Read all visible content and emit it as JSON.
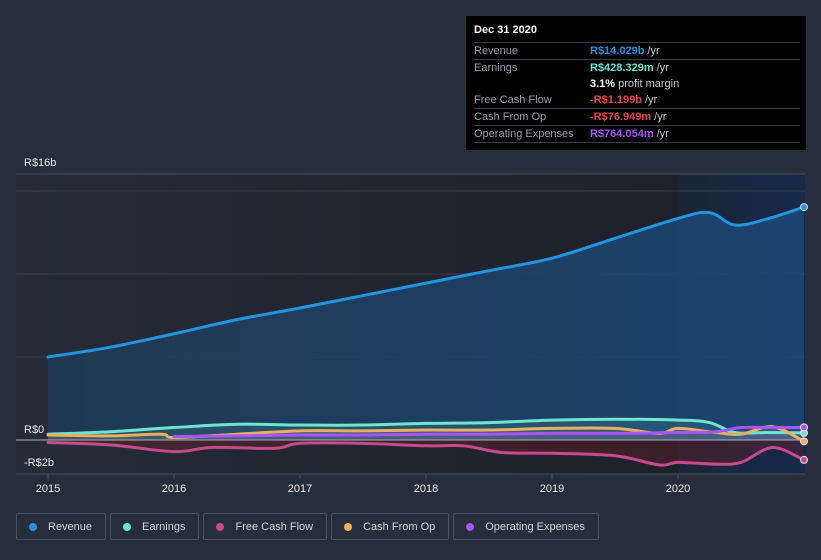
{
  "tooltip": {
    "date": "Dec 31 2020",
    "rows": [
      {
        "label": "Revenue",
        "value": "R$14.029b",
        "unit": "/yr",
        "color": "#2394df"
      },
      {
        "label": "Earnings",
        "value": "R$428.329m",
        "unit": "/yr",
        "color": "#6ce5d1"
      },
      {
        "label": "",
        "value": "3.1%",
        "unit": "profit margin",
        "color": "#ffffff"
      },
      {
        "label": "Free Cash Flow",
        "value": "-R$1.199b",
        "unit": "/yr",
        "color": "#e64545"
      },
      {
        "label": "Cash From Op",
        "value": "-R$76.949m",
        "unit": "/yr",
        "color": "#e64545"
      },
      {
        "label": "Operating Expenses",
        "value": "R$764.054m",
        "unit": "/yr",
        "color": "#a855f7"
      }
    ]
  },
  "legend": [
    {
      "label": "Revenue",
      "color": "#2394df"
    },
    {
      "label": "Earnings",
      "color": "#6ce5d1"
    },
    {
      "label": "Free Cash Flow",
      "color": "#c84a8c"
    },
    {
      "label": "Cash From Op",
      "color": "#e8b060"
    },
    {
      "label": "Operating Expenses",
      "color": "#a855f7"
    }
  ],
  "chart_data": {
    "type": "area",
    "title": "",
    "xlabel": "",
    "ylabel": "",
    "ylim": [
      -2,
      16
    ],
    "y_unit": "R$ billions",
    "y_tick_labels": [
      {
        "value": 16,
        "label": "R$16b"
      },
      {
        "value": 0,
        "label": "R$0"
      },
      {
        "value": -2,
        "label": "-R$2b"
      }
    ],
    "gridlines": [
      15,
      10,
      5
    ],
    "x_ticks": [
      "2015",
      "2016",
      "2017",
      "2018",
      "2019",
      "2020"
    ],
    "xlim": [
      2015,
      2021
    ],
    "highlight_start": 2020,
    "series": [
      {
        "name": "Revenue",
        "color": "#2394df",
        "x": [
          2015,
          2015.5,
          2016,
          2016.5,
          2017,
          2017.5,
          2018,
          2018.5,
          2019,
          2019.5,
          2020,
          2020.25,
          2020.45,
          2020.7,
          2021
        ],
        "values": [
          5.0,
          5.6,
          6.4,
          7.25,
          7.95,
          8.7,
          9.45,
          10.2,
          10.95,
          12.15,
          13.35,
          13.7,
          12.95,
          13.3,
          14.03
        ]
      },
      {
        "name": "Earnings",
        "color": "#6ce5d1",
        "x": [
          2015,
          2015.5,
          2016,
          2016.5,
          2017,
          2017.5,
          2018,
          2018.5,
          2019,
          2019.5,
          2020,
          2020.25,
          2020.45,
          2020.7,
          2021
        ],
        "values": [
          0.35,
          0.5,
          0.75,
          0.95,
          0.9,
          0.9,
          1.0,
          1.05,
          1.2,
          1.25,
          1.2,
          1.05,
          0.45,
          0.45,
          0.43
        ]
      },
      {
        "name": "Free Cash Flow",
        "color": "#c84a8c",
        "x": [
          2015,
          2015.5,
          2016,
          2016.3,
          2016.8,
          2017,
          2017.5,
          2018,
          2018.3,
          2018.6,
          2019,
          2019.5,
          2019.85,
          2020,
          2020.3,
          2020.5,
          2020.75,
          2021
        ],
        "values": [
          -0.15,
          -0.3,
          -0.7,
          -0.45,
          -0.5,
          -0.2,
          -0.2,
          -0.35,
          -0.35,
          -0.75,
          -0.8,
          -0.95,
          -1.5,
          -1.35,
          -1.45,
          -1.35,
          -0.45,
          -1.2
        ]
      },
      {
        "name": "Cash From Op",
        "color": "#e8b060",
        "x": [
          2015,
          2015.5,
          2015.9,
          2016,
          2016.5,
          2017,
          2017.5,
          2018,
          2018.5,
          2019,
          2019.5,
          2019.85,
          2020,
          2020.3,
          2020.5,
          2020.75,
          2021
        ],
        "values": [
          0.3,
          0.25,
          0.35,
          0.15,
          0.35,
          0.55,
          0.55,
          0.6,
          0.6,
          0.7,
          0.7,
          0.4,
          0.7,
          0.45,
          0.35,
          0.8,
          -0.08
        ]
      },
      {
        "name": "Operating Expenses",
        "color": "#a855f7",
        "x": [
          2016,
          2016.5,
          2017,
          2017.5,
          2018,
          2018.5,
          2019,
          2019.5,
          2020,
          2020.3,
          2020.5,
          2020.75,
          2021
        ],
        "values": [
          0.2,
          0.25,
          0.3,
          0.3,
          0.35,
          0.35,
          0.4,
          0.4,
          0.45,
          0.5,
          0.75,
          0.75,
          0.76
        ]
      }
    ]
  }
}
